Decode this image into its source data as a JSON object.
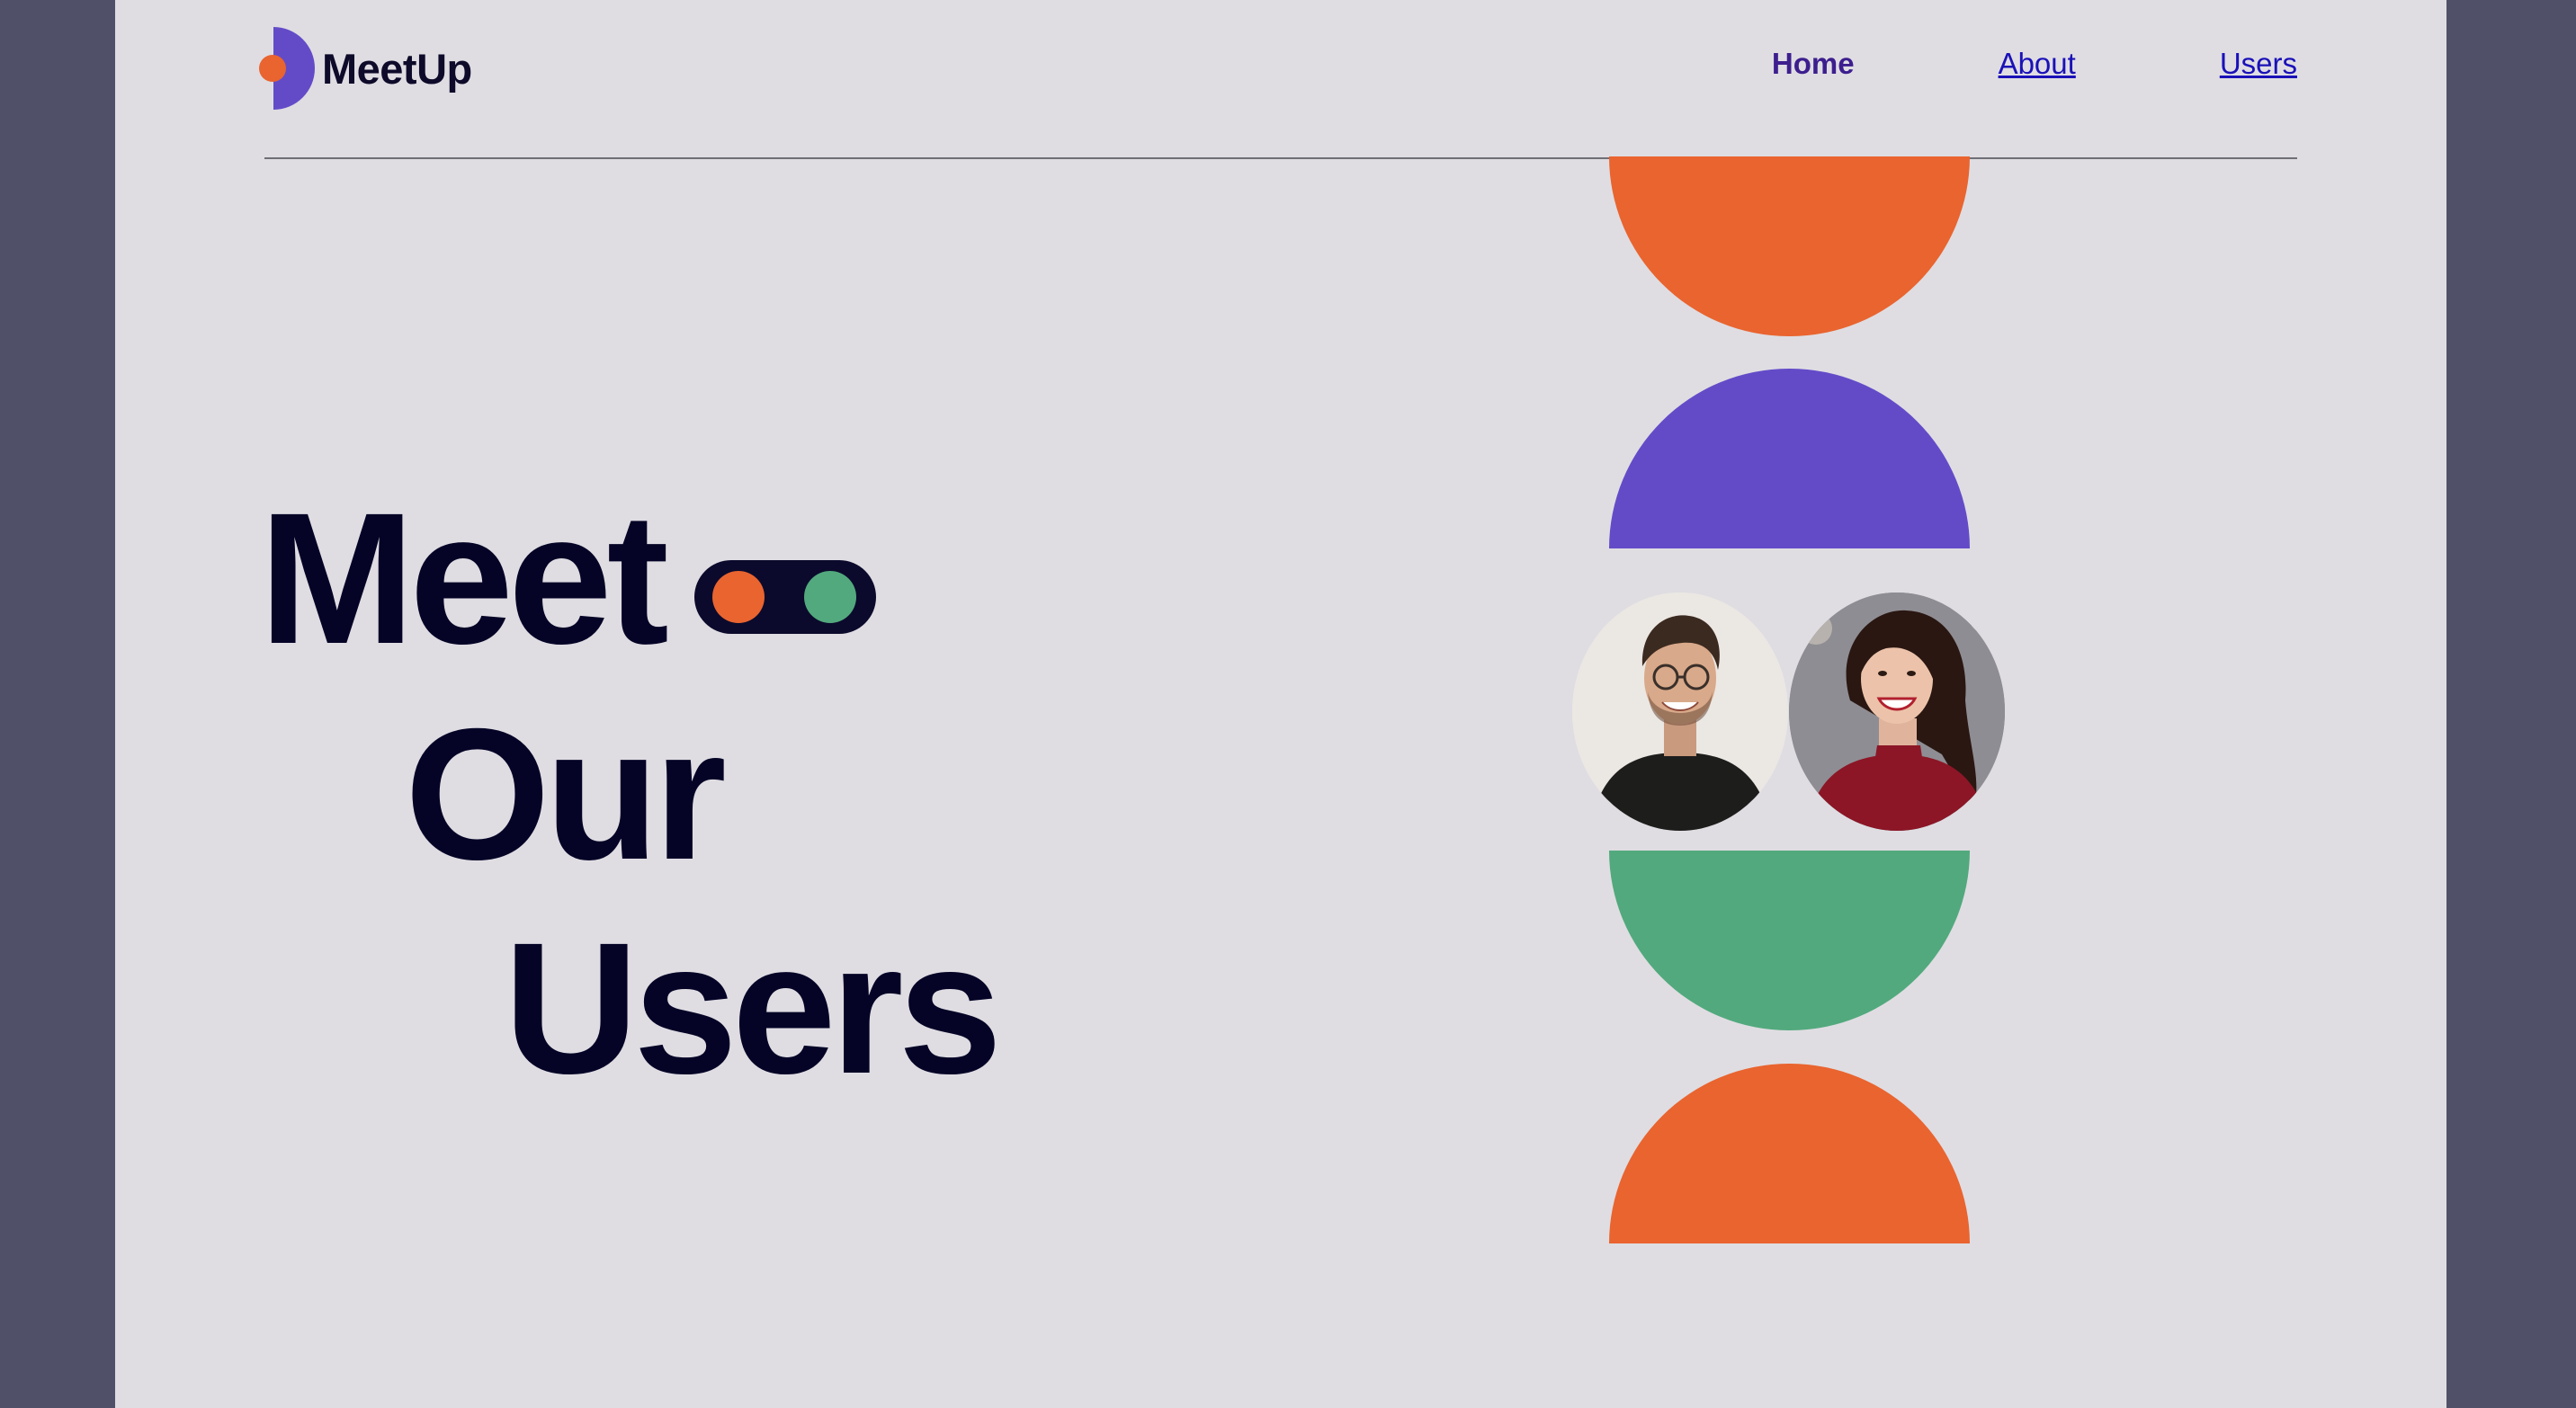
{
  "header": {
    "logo_text": "MeetUp",
    "logo_icon": "half-circle-dot-logo-icon",
    "nav": [
      {
        "label": "Home",
        "active": true
      },
      {
        "label": "About",
        "active": false
      },
      {
        "label": "Users",
        "active": false
      }
    ]
  },
  "hero": {
    "line1": "Meet",
    "line2": "Our",
    "line3": "Users",
    "toggle_icon": "two-dot-toggle-icon"
  },
  "avatars": [
    {
      "description": "smiling man with glasses",
      "icon": "user-avatar"
    },
    {
      "description": "smiling woman in red top",
      "icon": "user-avatar"
    }
  ],
  "colors": {
    "orange": "#e9642f",
    "purple": "#634bc8",
    "green": "#52a97d",
    "navy": "#050427",
    "background": "#dfdde2",
    "frame": "#505068"
  }
}
